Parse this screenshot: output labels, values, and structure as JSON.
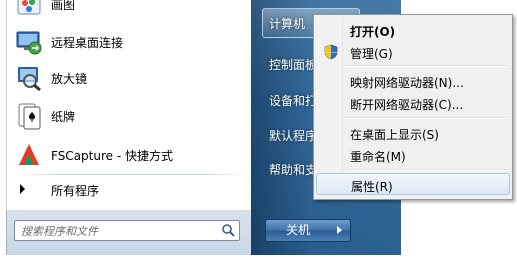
{
  "start_menu": {
    "programs": [
      {
        "label": "画图",
        "icon": "paint-icon"
      },
      {
        "label": "远程桌面连接",
        "icon": "remote-desktop-icon"
      },
      {
        "label": "放大镜",
        "icon": "magnifier-icon"
      },
      {
        "label": "纸牌",
        "icon": "solitaire-icon"
      },
      {
        "label": "FSCapture - 快捷方式",
        "icon": "fscapture-icon"
      }
    ],
    "all_programs": "所有程序",
    "search_placeholder": "搜索程序和文件",
    "right_pane": {
      "items": [
        "计算机",
        "控制面板",
        "设备和打",
        "默认程序",
        "帮助和支"
      ]
    },
    "shutdown_label": "关机"
  },
  "context_menu": {
    "items": [
      {
        "label": "打开(O)",
        "bold": true
      },
      {
        "label": "管理(G)",
        "icon": "shield-icon"
      },
      {
        "label": "映射网络驱动器(N)..."
      },
      {
        "label": "断开网络驱动器(C)..."
      },
      {
        "label": "在桌面上显示(S)"
      },
      {
        "label": "重命名(M)"
      },
      {
        "label": "属性(R)",
        "hover": true
      }
    ]
  },
  "colors": {
    "right_pane_blue": "#2d6597",
    "menu_bg": "#f0f0f0",
    "hover_border": "#a8c6ea"
  }
}
